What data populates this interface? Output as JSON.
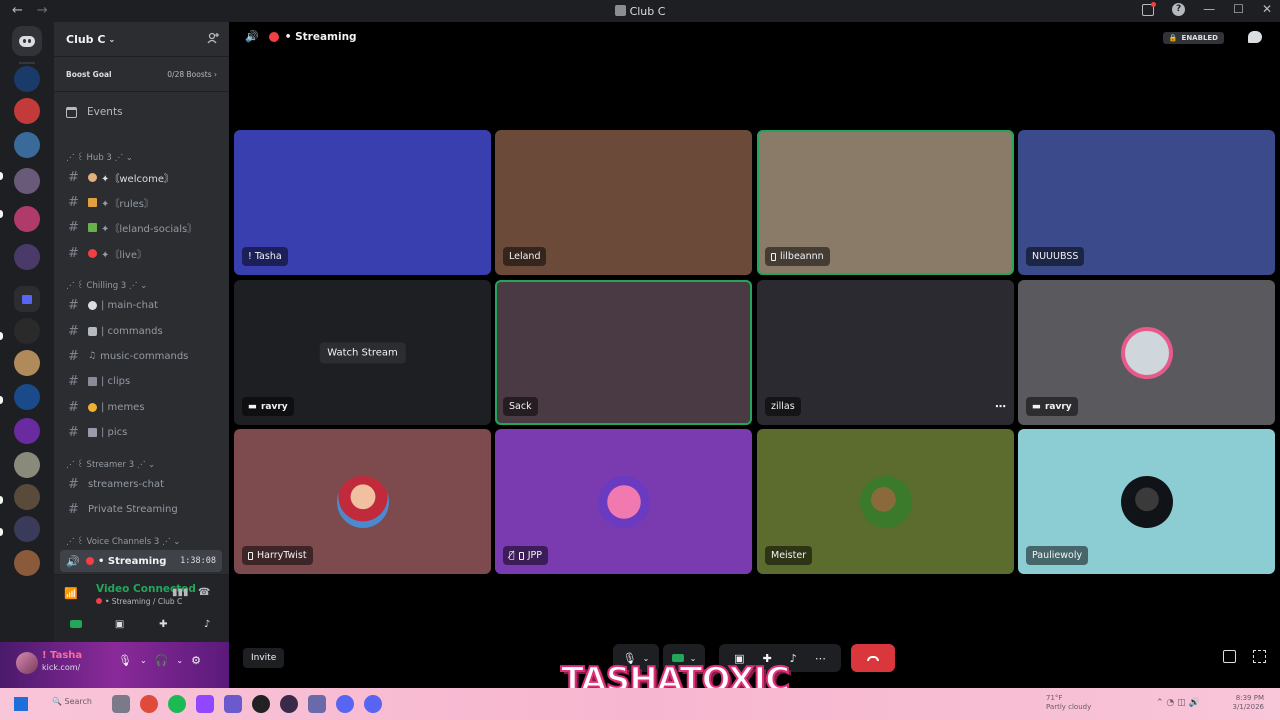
{
  "window": {
    "title": "Club C"
  },
  "server": {
    "name": "Club C",
    "boost_label": "Boost Goal",
    "boost_count": "0/28 Boosts",
    "events_label": "Events"
  },
  "categories": {
    "hub": "⋰ ꒰ Hub 3 ⋰ ⌄",
    "chilling": "⋰ ꒰ Chilling 3 ⋰ ⌄",
    "streamer": "⋰ ꒰ Streamer 3 ⋰ ⌄",
    "voice": "⋰ ꒰ Voice Channels 3 ⋰ ⌄"
  },
  "channels": {
    "welcome": "✦〘welcome〙",
    "rules": "✦〘rules〙",
    "leland_socials": "✦〘leland-socials〙",
    "live": "✦〘live〙",
    "main_chat": "| main-chat",
    "commands": "| commands",
    "music_commands": "music-commands",
    "clips": "| clips",
    "memes": "| memes",
    "pics": "| pics",
    "streamers_chat": "streamers-chat",
    "private_streaming": "Private Streaming"
  },
  "voice": {
    "channel": "• Streaming",
    "timer": "1:38:08"
  },
  "rtc": {
    "status": "Video Connected",
    "location": "• Streaming / Club C"
  },
  "user": {
    "name": "! Tasha",
    "status": "kick.com/"
  },
  "main": {
    "channel": "• Streaming",
    "enabled_badge": "ENABLED"
  },
  "tiles": [
    {
      "name": "! Tasha",
      "color": "#3a3fb0"
    },
    {
      "name": "Leland",
      "color": "#6b4a3a"
    },
    {
      "name": "lilbeannn",
      "color": "#8a7a68",
      "phone": true
    },
    {
      "name": "NUUUBSS",
      "color": "#3a4a8a"
    },
    {
      "name": "ravry",
      "color": "#1e1f22",
      "watch": "Watch Stream"
    },
    {
      "name": "Sack",
      "color": "#4a3a44"
    },
    {
      "name": "zillas",
      "color": "#2a2a30"
    },
    {
      "name": "ravry",
      "color": "#5a5a5e"
    },
    {
      "name": "HarryTwist",
      "color": "#7d4a4e",
      "phone": true
    },
    {
      "name": "JPP",
      "color": "#7a3ab0",
      "phone": true
    },
    {
      "name": "Meister",
      "color": "#5c6b2e"
    },
    {
      "name": "Pauliewoly",
      "color": "#8ccdd4"
    }
  ],
  "bottom": {
    "invite": "Invite"
  },
  "overlay": {
    "text": "TASHATOXIC"
  },
  "taskbar": {
    "search": "Search",
    "weather_temp": "71°F",
    "weather_desc": "Partly cloudy",
    "time": "8:39 PM",
    "date": "3/1/2026"
  }
}
